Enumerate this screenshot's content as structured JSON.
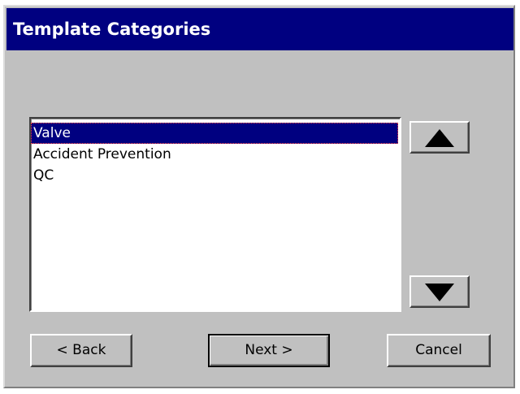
{
  "window": {
    "title": "Template Categories"
  },
  "list": {
    "items": [
      {
        "label": "Valve",
        "selected": true
      },
      {
        "label": "Accident Prevention",
        "selected": false
      },
      {
        "label": "QC",
        "selected": false
      }
    ]
  },
  "controls": {
    "move_up_icon": "triangle-up-icon",
    "move_down_icon": "triangle-down-icon"
  },
  "buttons": {
    "back_label": "< Back",
    "next_label": "Next >",
    "cancel_label": "Cancel"
  },
  "colors": {
    "titlebar": "#000080",
    "face": "#c0c0c0",
    "selection": "#000080"
  }
}
